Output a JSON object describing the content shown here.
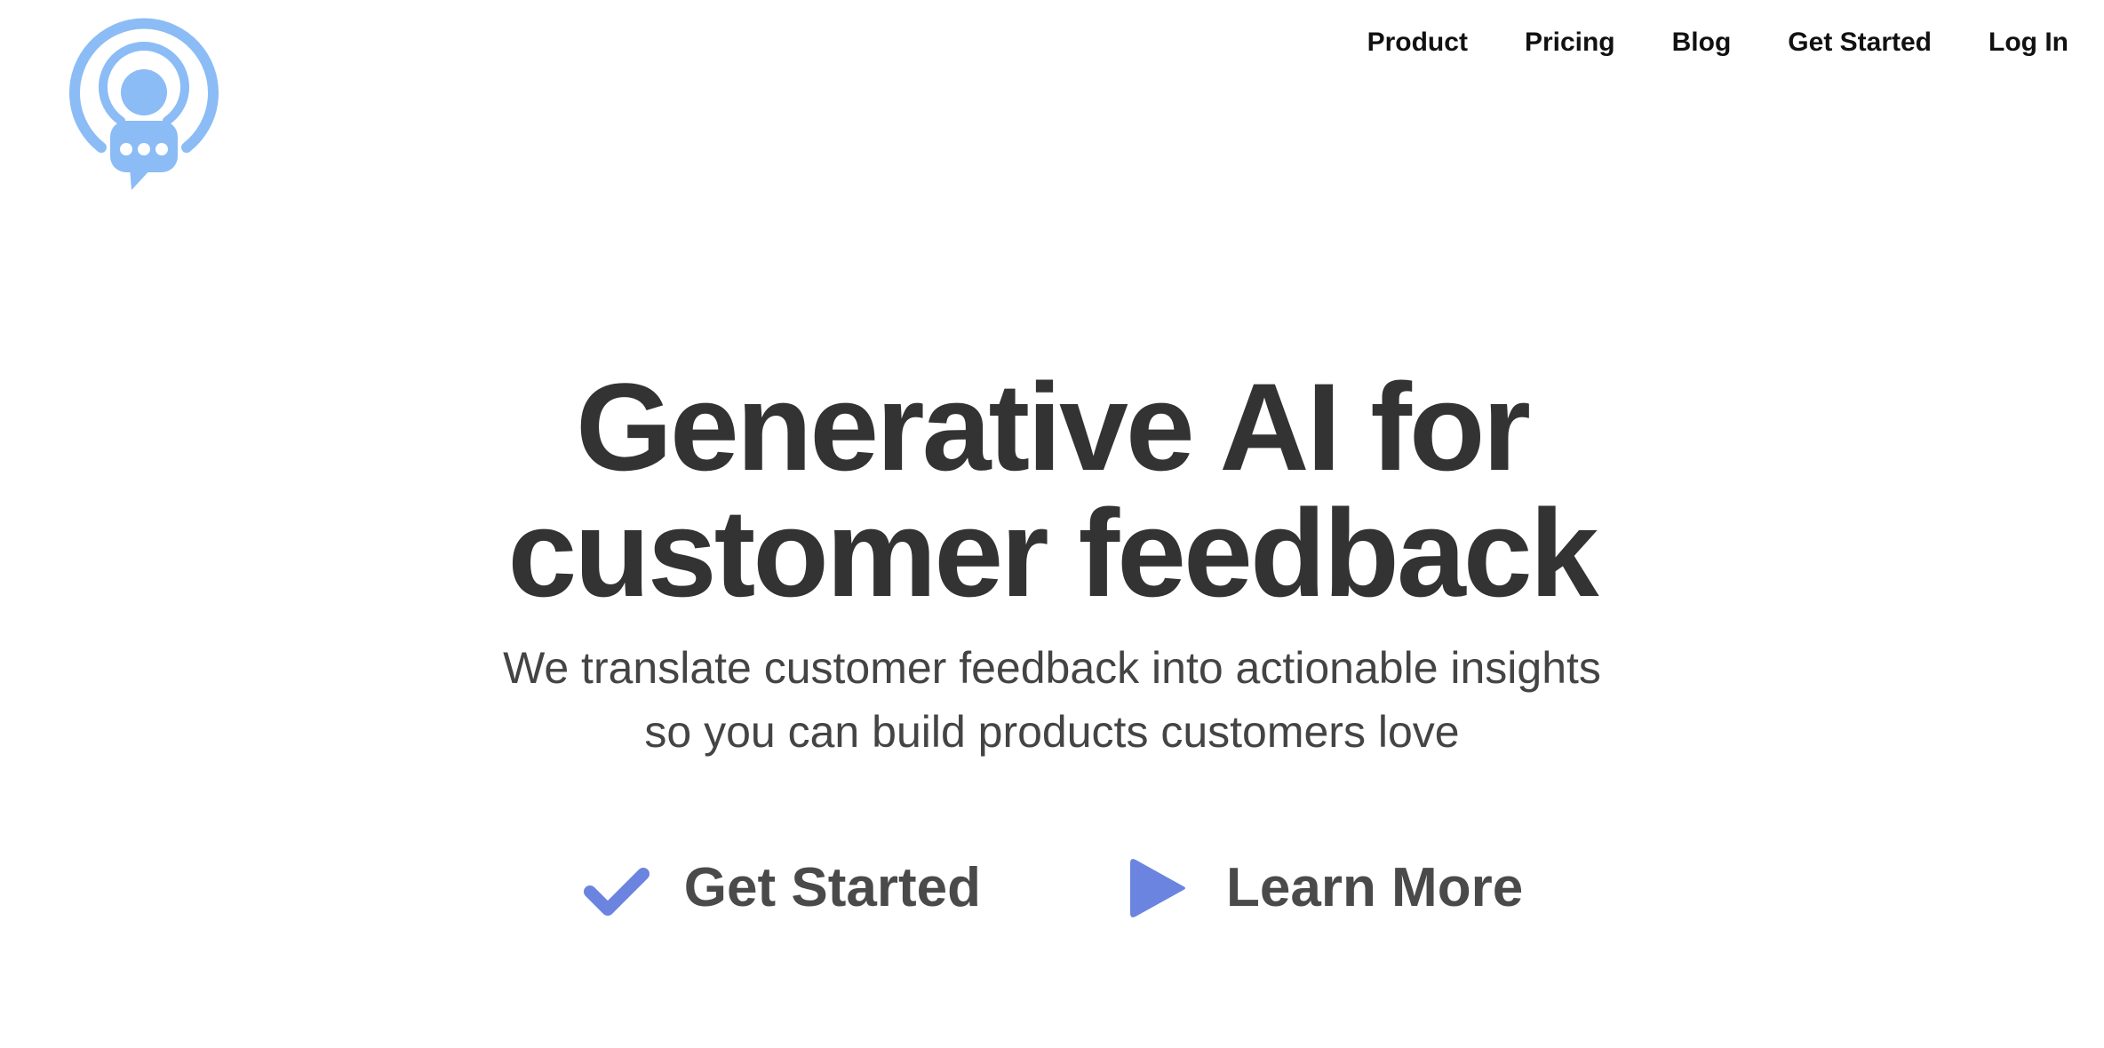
{
  "brand": {
    "logo_icon": "podcast-person-chat-icon",
    "logo_color": "#8bbcf5"
  },
  "nav": {
    "items": [
      {
        "label": "Product"
      },
      {
        "label": "Pricing"
      },
      {
        "label": "Blog"
      },
      {
        "label": "Get Started"
      },
      {
        "label": "Log In"
      }
    ]
  },
  "hero": {
    "headline_line1": "Generative AI for",
    "headline_line2": "customer feedback",
    "subtitle_line1": "We translate customer feedback into actionable insights",
    "subtitle_line2": "so you can build products customers love"
  },
  "cta": {
    "get_started": {
      "label": "Get Started",
      "icon": "checkmark-icon"
    },
    "learn_more": {
      "label": "Learn More",
      "icon": "play-icon"
    },
    "accent_color": "#6b84df"
  }
}
